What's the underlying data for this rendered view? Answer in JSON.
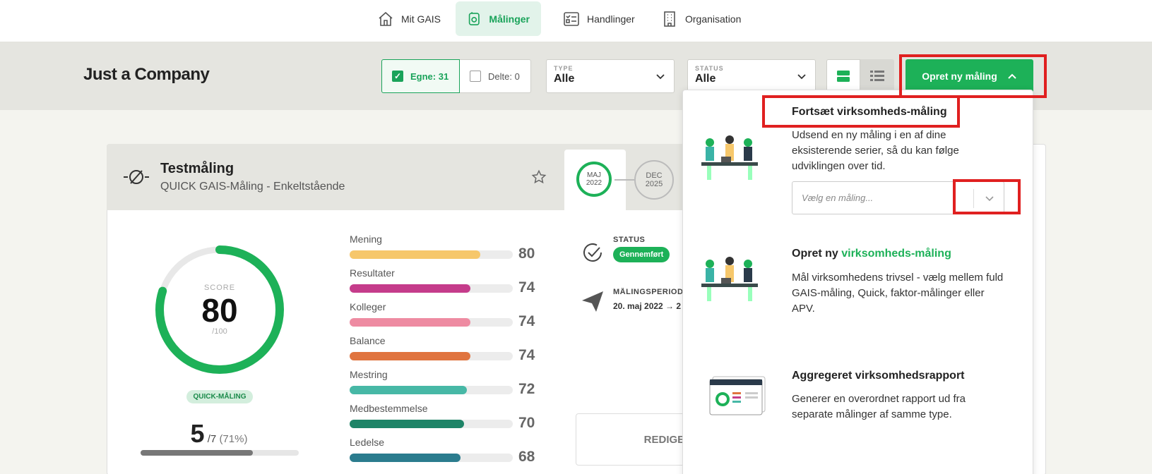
{
  "nav": {
    "items": [
      {
        "label": "Mit GAIS",
        "icon": "house-icon"
      },
      {
        "label": "Målinger",
        "icon": "measurement-icon",
        "active": true
      },
      {
        "label": "Handlinger",
        "icon": "checklist-icon"
      },
      {
        "label": "Organisation",
        "icon": "building-icon"
      }
    ]
  },
  "header": {
    "company": "Just a Company",
    "filters": {
      "egne": "Egne: 31",
      "delte": "Delte: 0"
    },
    "type": {
      "label": "TYPE",
      "value": "Alle"
    },
    "status": {
      "label": "STATUS",
      "value": "Alle"
    },
    "create_button": "Opret ny måling"
  },
  "card": {
    "title": "Testmåling",
    "subtitle": "QUICK GAIS-Måling - Enkeltstående",
    "timeline": [
      {
        "month": "MAJ",
        "year": "2022"
      },
      {
        "month": "DEC",
        "year": "2025"
      }
    ],
    "score": {
      "label": "SCORE",
      "value": "80",
      "max": "/100",
      "fraction": 0.8
    },
    "badge": "QUICK-MÅLING",
    "responses": {
      "count": "5",
      "total": "/7",
      "pct": "(71%)",
      "fraction": 0.71
    },
    "metrics": [
      {
        "name": "Mening",
        "value": 80,
        "color": "#f6c76b"
      },
      {
        "name": "Resultater",
        "value": 74,
        "color": "#c53c8b"
      },
      {
        "name": "Kolleger",
        "value": 74,
        "color": "#ee8ba2"
      },
      {
        "name": "Balance",
        "value": 74,
        "color": "#e0743f"
      },
      {
        "name": "Mestring",
        "value": 72,
        "color": "#47b8a6"
      },
      {
        "name": "Medbestemmelse",
        "value": 70,
        "color": "#1e8467"
      },
      {
        "name": "Ledelse",
        "value": 68,
        "color": "#2b7c8e"
      }
    ],
    "status": {
      "label": "STATUS",
      "value": "Gennemført"
    },
    "period": {
      "label": "MÅLINGSPERIODE",
      "value": "20. maj 2022 → 2"
    },
    "edit_button": "REDIGER"
  },
  "dropdown": {
    "sections": [
      {
        "title": "Fortsæt virksomheds-måling",
        "desc": "Udsend en ny måling i en af dine eksisterende serier, så du kan følge udviklingen over tid.",
        "select_placeholder": "Vælg en måling..."
      },
      {
        "title_prefix": "Opret ny ",
        "title_accent": "virksomheds-måling",
        "desc": "Mål virksomhedens trivsel - vælg mellem fuld GAIS-måling, Quick, faktor-målinger eller APV."
      },
      {
        "title": "Aggregeret virksomhedsrapport",
        "desc": "Generer en overordnet rapport ud fra separate målinger af samme type."
      }
    ]
  },
  "colors": {
    "accent": "#1db158",
    "highlight": "#e02020"
  }
}
